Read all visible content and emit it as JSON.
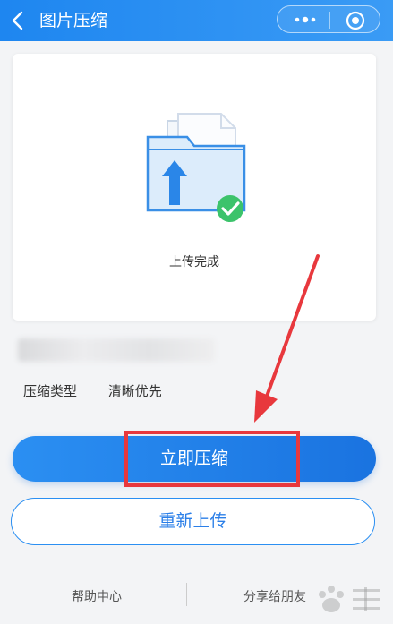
{
  "header": {
    "title": "图片压缩"
  },
  "upload": {
    "status": "上传完成"
  },
  "settings": {
    "type_label": "压缩类型",
    "type_value": "清晰优先"
  },
  "actions": {
    "compress": "立即压缩",
    "reupload": "重新上传"
  },
  "footer": {
    "help": "帮助中心",
    "share": "分享给朋友"
  },
  "colors": {
    "accent": "#1e86f0",
    "highlight": "#e8383d",
    "success": "#3cc36b"
  }
}
